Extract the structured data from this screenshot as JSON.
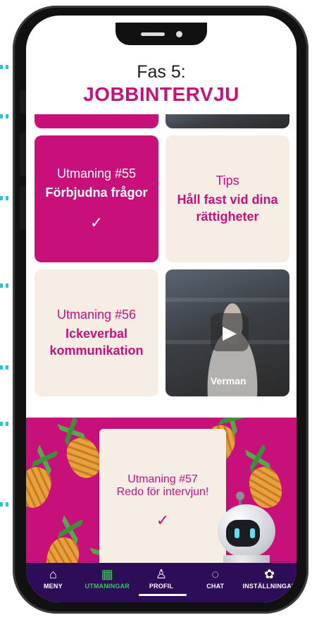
{
  "header": {
    "phase": "Fas 5:",
    "title": "JOBBINTERVJU"
  },
  "tiles": [
    {
      "line1": "Utmaning #55",
      "line2": "Förbjudna frågor",
      "completed": true,
      "style": "pink"
    },
    {
      "line1": "Tips",
      "line2": "Håll fast vid dina rättigheter",
      "style": "cream"
    },
    {
      "line1": "Utmaning #56",
      "line2": "Ickeverbal kommunikation",
      "style": "cream"
    },
    {
      "video_label": "Verman",
      "play_icon": "play-icon"
    },
    {
      "line1": "Utmaning #57",
      "line2": "Redo för intervjun!",
      "completed": true,
      "style": "featured"
    }
  ],
  "checkmark": "✓",
  "tabbar": {
    "items": [
      {
        "label": "MENY",
        "icon": "home-icon",
        "active": false
      },
      {
        "label": "UTMANINGAR",
        "icon": "grid-icon",
        "active": true
      },
      {
        "label": "PROFIL",
        "icon": "profile-icon",
        "active": false
      },
      {
        "label": "CHAT",
        "icon": "chat-icon",
        "active": false
      },
      {
        "label": "INSTÄLLNINGAR",
        "icon": "gear-icon",
        "active": false
      }
    ]
  },
  "colors": {
    "accent": "#c8107a",
    "cream": "#f6ede4",
    "tabbar": "#2d0d58",
    "active_tab": "#36c95a"
  }
}
